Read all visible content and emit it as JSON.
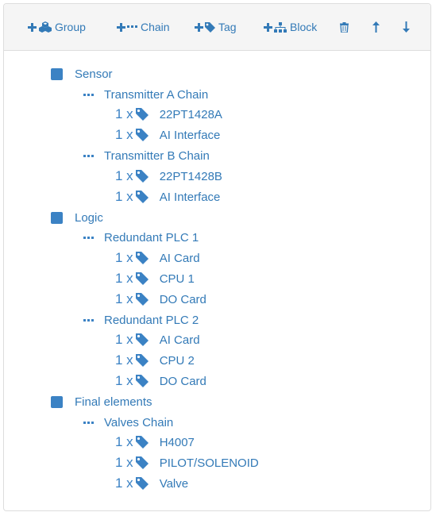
{
  "toolbar": {
    "group_label": "Group",
    "chain_label": "Chain",
    "tag_label": "Tag",
    "block_label": "Block",
    "delete_icon": "trash-icon",
    "up_icon": "arrow-up-icon",
    "down_icon": "arrow-down-icon"
  },
  "tree": {
    "groups": [
      {
        "label": "Sensor",
        "chains": [
          {
            "label": "Transmitter A Chain",
            "tags": [
              {
                "qty": "1 x",
                "label": "22PT1428A"
              },
              {
                "qty": "1 x",
                "label": "AI Interface"
              }
            ]
          },
          {
            "label": "Transmitter B Chain",
            "tags": [
              {
                "qty": "1 x",
                "label": "22PT1428B"
              },
              {
                "qty": "1 x",
                "label": "AI Interface"
              }
            ]
          }
        ]
      },
      {
        "label": "Logic",
        "chains": [
          {
            "label": "Redundant PLC 1",
            "tags": [
              {
                "qty": "1 x",
                "label": "AI Card"
              },
              {
                "qty": "1 x",
                "label": "CPU 1"
              },
              {
                "qty": "1 x",
                "label": "DO Card"
              }
            ]
          },
          {
            "label": "Redundant PLC 2",
            "tags": [
              {
                "qty": "1 x",
                "label": "AI Card"
              },
              {
                "qty": "1 x",
                "label": "CPU 2"
              },
              {
                "qty": "1 x",
                "label": "DO Card"
              }
            ]
          }
        ]
      },
      {
        "label": "Final elements",
        "chains": [
          {
            "label": "Valves Chain",
            "tags": [
              {
                "qty": "1 x",
                "label": "H4007"
              },
              {
                "qty": "1 x",
                "label": "PILOT/SOLENOID"
              },
              {
                "qty": "1 x",
                "label": "Valve"
              }
            ]
          }
        ]
      }
    ]
  }
}
